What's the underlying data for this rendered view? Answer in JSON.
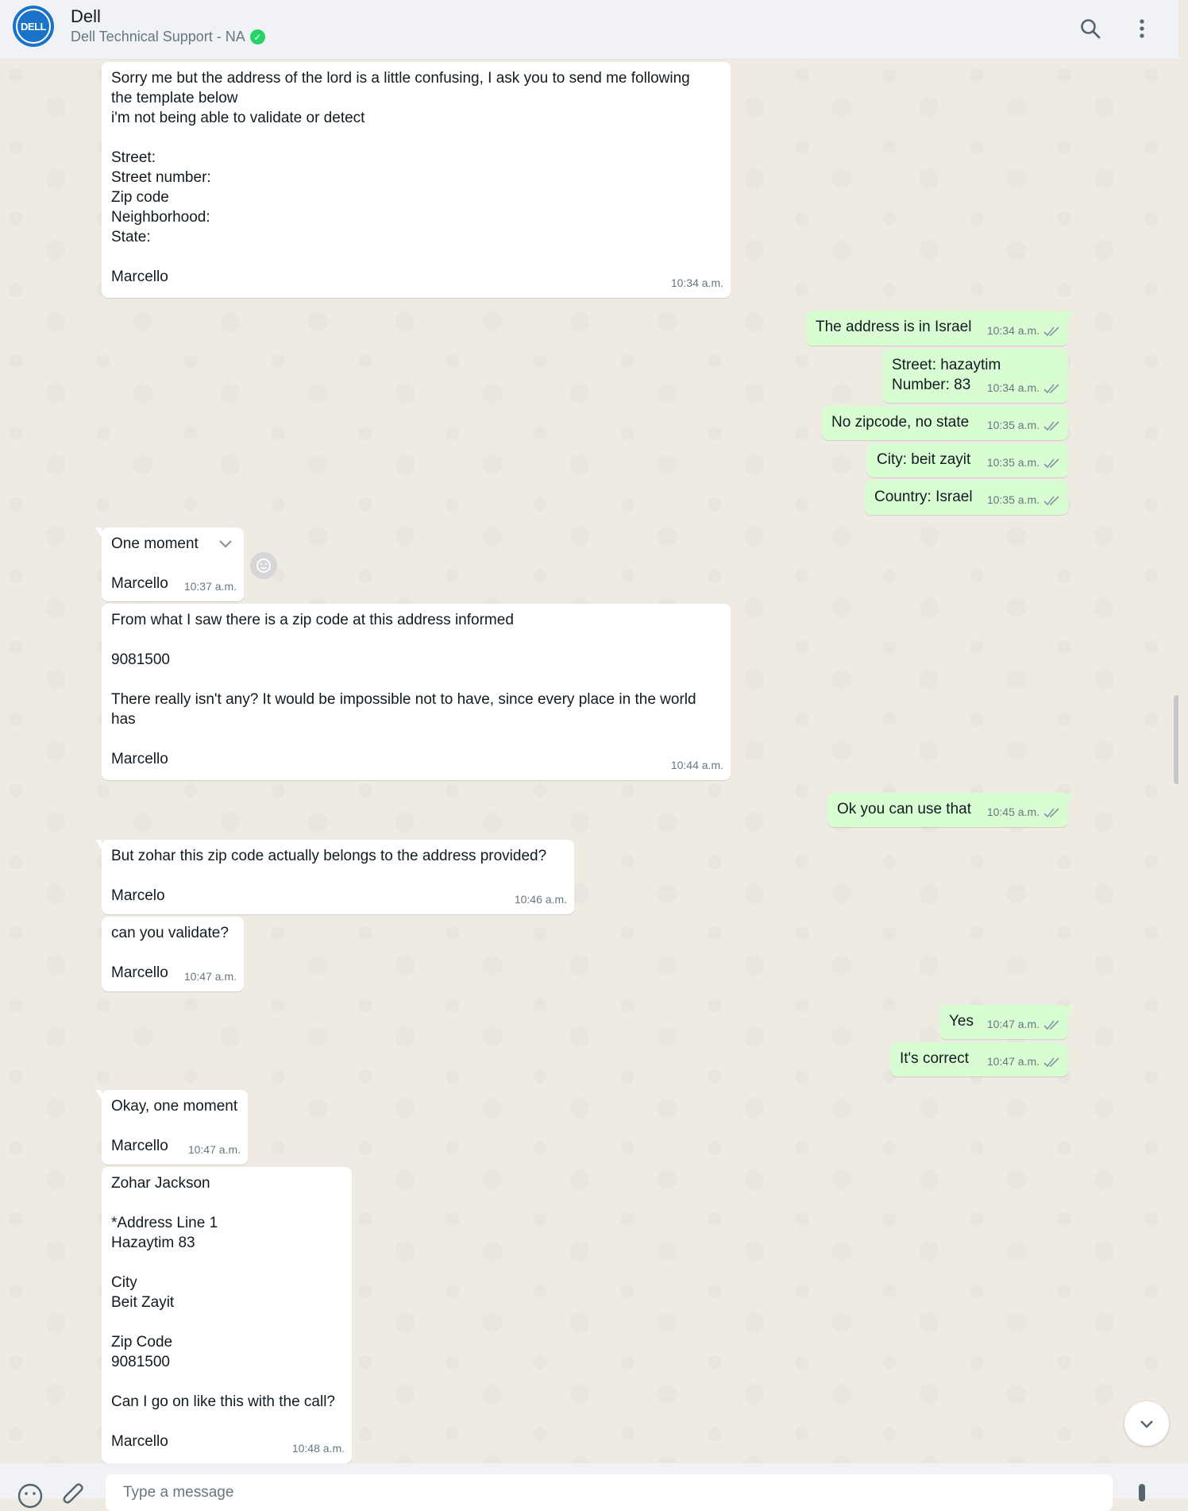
{
  "header": {
    "avatar_text": "DELL",
    "name": "Dell",
    "subtitle": "Dell Technical Support - NA"
  },
  "messages": [
    {
      "dir": "in",
      "text": "Sorry me but the address of the lord is a little confusing, I ask you to send me following\nthe template below\ni'm not being able to validate or detect\n\nStreet:\nStreet number:\nZip code\nNeighborhood:\nState:\n\nMarcello",
      "time": "10:34 a.m."
    },
    {
      "dir": "out",
      "text": "The address is in Israel",
      "time": "10:34 a.m."
    },
    {
      "dir": "out",
      "text": "Street: hazaytim\nNumber: 83",
      "time": "10:34 a.m."
    },
    {
      "dir": "out",
      "text": "No zipcode, no state",
      "time": "10:35 a.m."
    },
    {
      "dir": "out",
      "text": "City: beit zayit",
      "time": "10:35 a.m."
    },
    {
      "dir": "out",
      "text": "Country: Israel",
      "time": "10:35 a.m."
    },
    {
      "dir": "in",
      "text": "One moment\n\nMarcello",
      "time": "10:37 a.m."
    },
    {
      "dir": "in",
      "text": "From what I saw there is a zip code at this address informed\n\n9081500\n\nThere really isn't any? It would be impossible not to have, since every place in the world\nhas\n\nMarcello",
      "time": "10:44 a.m."
    },
    {
      "dir": "out",
      "text": "Ok you can use that",
      "time": "10:45 a.m."
    },
    {
      "dir": "in",
      "text": "But zohar this zip code actually belongs to the address provided?\n\nMarcelo",
      "time": "10:46 a.m."
    },
    {
      "dir": "in",
      "text": "can you validate?\n\nMarcello",
      "time": "10:47 a.m."
    },
    {
      "dir": "out",
      "text": "Yes",
      "time": "10:47 a.m."
    },
    {
      "dir": "out",
      "text": "It's correct",
      "time": "10:47 a.m."
    },
    {
      "dir": "in",
      "text": "Okay, one moment\n\nMarcello",
      "time": "10:47 a.m."
    },
    {
      "dir": "in",
      "text": "Zohar Jackson\n\n*Address Line 1\nHazaytim 83\n\nCity\nBeit Zayit\n\nZip Code\n9081500\n\nCan I go on like this with the call?\n\nMarcello",
      "time": "10:48 a.m."
    }
  ],
  "composer": {
    "placeholder": "Type a message"
  },
  "colors": {
    "incoming_bubble": "#ffffff",
    "outgoing_bubble": "#d9fdd3",
    "chat_background": "#efeae2",
    "verified_badge": "#25d366",
    "read_ticks": "#8696a0"
  }
}
